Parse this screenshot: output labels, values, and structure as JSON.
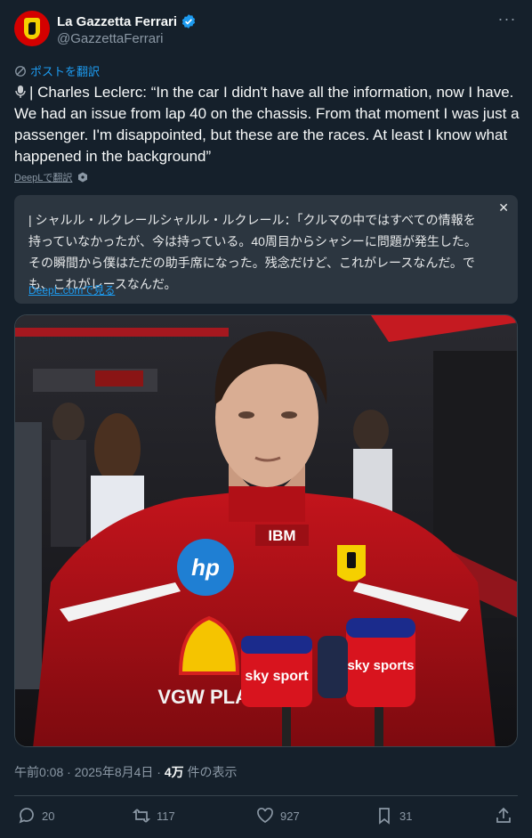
{
  "author": {
    "display_name": "La Gazzetta Ferrari",
    "handle": "@GazzettaFerrari"
  },
  "translate_post_label": "ポストを翻訳",
  "tweet": {
    "text": "| Charles Leclerc: “In the car I didn't have all the information, now I have. We had an issue from lap 40 on the chassis. From that moment I was just a passenger. I'm disappointed, but these are the races. At least I know what happened in the background”"
  },
  "deepl": {
    "translated_by_label": "DeepLで翻訳",
    "translation_text": "| シャルル・ルクレールシャルル・ルクレール：「クルマの中ではすべての情報を持っていなかったが、今は持っている。40周目からシャシーに問題が発生した。その瞬間から僕はただの助手席になった。残念だけど、これがレースなんだ。でも、これがレースなんだ。",
    "view_on_site_label": "DeepL.comで見る"
  },
  "photo": {
    "shirt_logos": [
      "IBM",
      "sky sport",
      "sky sports",
      "VGW PLAY"
    ]
  },
  "meta": {
    "timestamp": "午前0:08 · 2025年8月4日",
    "separator": " · ",
    "views_count": "4万",
    "views_label": " 件の表示"
  },
  "actions": {
    "replies": "20",
    "reposts": "117",
    "likes": "927",
    "bookmarks": "31"
  },
  "colors": {
    "background": "#15202b",
    "accent": "#1d9bf0",
    "muted": "#8b98a5",
    "ferrari_red": "#d40000"
  }
}
